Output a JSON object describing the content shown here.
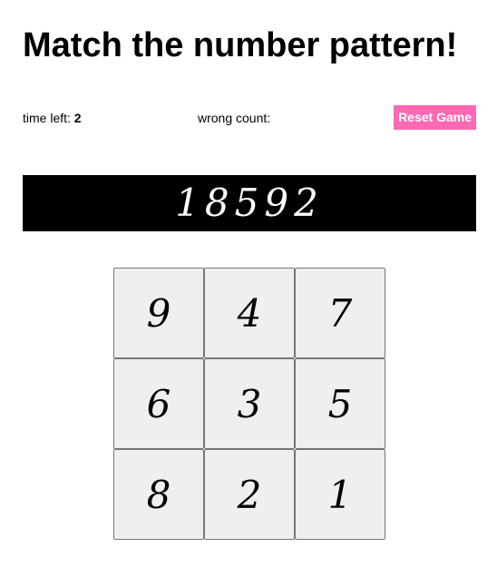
{
  "title": "Match the number pattern!",
  "status": {
    "time_left_label": "time left: ",
    "time_left_value": "2",
    "wrong_count_label": "wrong count:",
    "wrong_count_value": ""
  },
  "reset_button_label": "Reset Game",
  "pattern": "18592",
  "grid": [
    "9",
    "4",
    "7",
    "6",
    "3",
    "5",
    "8",
    "2",
    "1"
  ],
  "colors": {
    "accent": "#ff69b4",
    "pattern_bg": "#000000",
    "cell_bg": "#efefef"
  }
}
